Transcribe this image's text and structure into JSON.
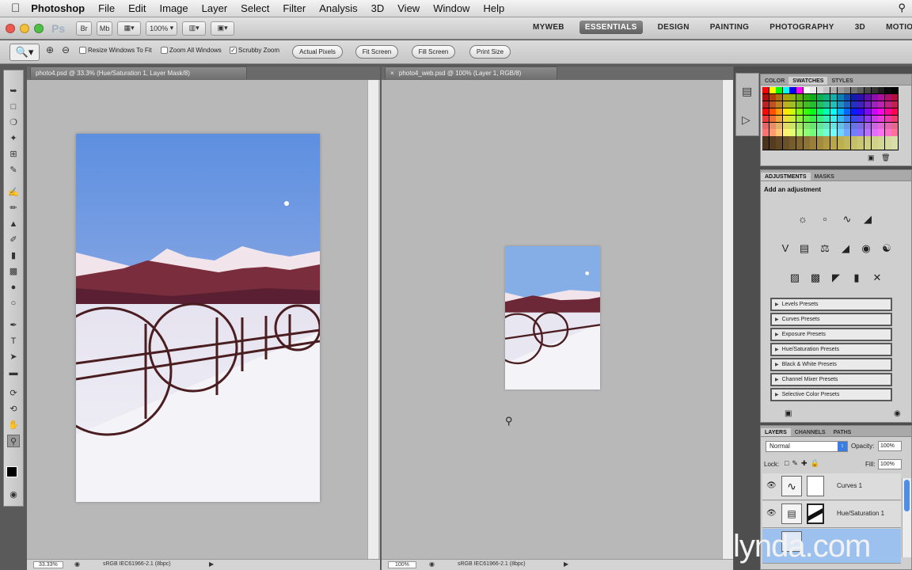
{
  "menubar": {
    "apple": "",
    "items": [
      "Photoshop",
      "File",
      "Edit",
      "Image",
      "Layer",
      "Select",
      "Filter",
      "Analysis",
      "3D",
      "View",
      "Window",
      "Help"
    ]
  },
  "appbar": {
    "ps_logo": "Ps",
    "zoom": "100%",
    "workspaces": [
      "MYWEB",
      "ESSENTIALS",
      "DESIGN",
      "PAINTING",
      "PHOTOGRAPHY",
      "3D",
      "MOTION"
    ],
    "overflow": "»"
  },
  "options": {
    "checkboxes": [
      "Resize Windows To Fit",
      "Zoom All Windows",
      "Scrubby Zoom"
    ],
    "buttons": [
      "Actual Pixels",
      "Fit Screen",
      "Fill Screen",
      "Print Size"
    ]
  },
  "doc1": {
    "tab": "photo4.psd @ 33.3% (Hue/Saturation 1, Layer Mask/8)",
    "zoom": "33.33%",
    "profile": "sRGB IEC61966-2.1 (8bpc)"
  },
  "doc2": {
    "tab": "photo4_web.psd @ 100% (Layer 1, RGB/8)",
    "zoom": "100%",
    "profile": "sRGB IEC61966-2.1 (8bpc)"
  },
  "swatches": {
    "tabs": [
      "COLOR",
      "SWATCHES",
      "STYLES"
    ],
    "active": "SWATCHES"
  },
  "adjustments": {
    "tabs": [
      "ADJUSTMENTS",
      "MASKS"
    ],
    "heading": "Add an adjustment",
    "presets": [
      "Levels Presets",
      "Curves Presets",
      "Exposure Presets",
      "Hue/Saturation Presets",
      "Black & White Presets",
      "Channel Mixer Presets",
      "Selective Color Presets"
    ]
  },
  "layers": {
    "tabs": [
      "LAYERS",
      "CHANNELS",
      "PATHS"
    ],
    "blend": "Normal",
    "opacity_label": "Opacity:",
    "opacity": "100%",
    "lock_label": "Lock:",
    "fill_label": "Fill:",
    "fill": "100%",
    "rows": [
      "Curves 1",
      "Hue/Saturation 1"
    ]
  },
  "watermark": "lynda.com",
  "colors": {
    "accent": "#3b7de0",
    "doc_bg": "#b8b8b8"
  }
}
